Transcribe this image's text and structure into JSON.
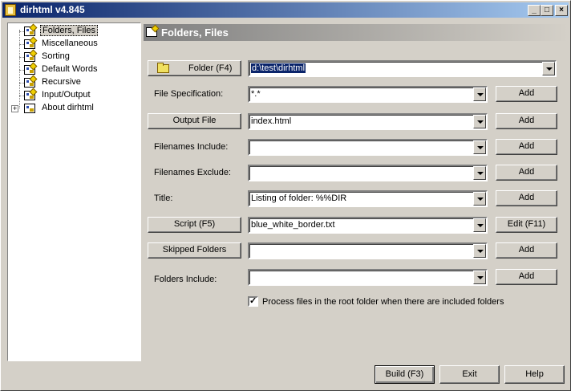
{
  "window": {
    "title": "dirhtml v4.845",
    "controls": {
      "minimize": "_",
      "maximize": "□",
      "close": "×"
    }
  },
  "tree": {
    "items": [
      {
        "label": "Folders, Files",
        "selected": true
      },
      {
        "label": "Miscellaneous"
      },
      {
        "label": "Sorting"
      },
      {
        "label": "Default Words"
      },
      {
        "label": "Recursive"
      },
      {
        "label": "Input/Output"
      },
      {
        "label": "About dirhtml",
        "expander": "+"
      }
    ]
  },
  "panel": {
    "title": "Folders, Files"
  },
  "form": {
    "folder_button": "Folder (F4)",
    "folder_value": "d:\\test\\dirhtml",
    "file_spec_label": "File Specification:",
    "file_spec_value": "*.*",
    "output_file_button": "Output File",
    "output_file_value": "index.html",
    "filenames_include_label": "Filenames Include:",
    "filenames_include_value": "",
    "filenames_exclude_label": "Filenames Exclude:",
    "filenames_exclude_value": "",
    "title_label": "Title:",
    "title_value": "Listing of folder: %%DIR",
    "script_button": "Script (F5)",
    "script_value": "blue_white_border.txt",
    "skipped_folders_button": "Skipped Folders",
    "skipped_folders_value": "",
    "folders_include_label": "Folders Include:",
    "folders_include_value": "",
    "add_label": "Add",
    "edit_label": "Edit (F11)",
    "process_root_checked": true,
    "process_root_label": "Process files in the root folder when there are included folders"
  },
  "footer": {
    "build": "Build (F3)",
    "exit": "Exit",
    "help": "Help"
  }
}
